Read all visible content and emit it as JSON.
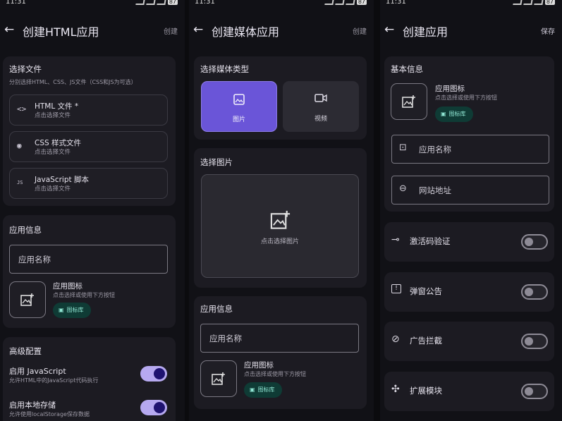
{
  "status": {
    "time": "11:31",
    "battery": "87"
  },
  "screen1": {
    "title": "创建HTML应用",
    "action": "创建",
    "select_files": {
      "heading": "选择文件",
      "hint": "分别选择HTML、CSS、JS文件（CSS和JS为可选）",
      "items": [
        {
          "icon": "code-icon",
          "glyph": "<>",
          "title": "HTML 文件 *",
          "sub": "点击选择文件"
        },
        {
          "icon": "palette-icon",
          "glyph": "◉",
          "title": "CSS 样式文件",
          "sub": "点击选择文件"
        },
        {
          "icon": "js-icon",
          "glyph": "JS",
          "title": "JavaScript 脚本",
          "sub": "点击选择文件"
        }
      ]
    },
    "app_info": {
      "heading": "应用信息",
      "name_placeholder": "应用名称",
      "icon_title": "应用图标",
      "icon_sub": "点击选择或使用下方按钮",
      "chip": "图标库"
    },
    "advanced": {
      "heading": "高级配置",
      "items": [
        {
          "title": "启用 JavaScript",
          "sub": "允许HTML中的JavaScript代码执行",
          "on": true
        },
        {
          "title": "启用本地存储",
          "sub": "允许使用localStorage保存数据",
          "on": true
        }
      ]
    }
  },
  "screen2": {
    "title": "创建媒体应用",
    "action": "创建",
    "media_type": {
      "heading": "选择媒体类型",
      "options": [
        {
          "label": "图片",
          "icon": "image-icon",
          "selected": true
        },
        {
          "label": "视频",
          "icon": "video-icon",
          "selected": false
        }
      ]
    },
    "pick_image": {
      "heading": "选择图片",
      "hint": "点击选择图片"
    },
    "app_info": {
      "heading": "应用信息",
      "name_placeholder": "应用名称",
      "icon_title": "应用图标",
      "icon_sub": "点击选择或使用下方按钮",
      "chip": "图标库"
    }
  },
  "screen3": {
    "title": "创建应用",
    "action": "保存",
    "basic": {
      "heading": "基本信息",
      "icon_title": "应用图标",
      "icon_sub": "点击选择或使用下方按钮",
      "chip": "图标库",
      "name_placeholder": "应用名称",
      "url_placeholder": "网站地址"
    },
    "options": [
      {
        "label": "激活码验证",
        "icon": "key-icon",
        "glyph": "⊸",
        "on": false
      },
      {
        "label": "弹窗公告",
        "icon": "announcement-icon",
        "glyph": "!",
        "on": false
      },
      {
        "label": "广告拦截",
        "icon": "block-icon",
        "glyph": "⊘",
        "on": false
      },
      {
        "label": "扩展模块",
        "icon": "puzzle-icon",
        "glyph": "✣",
        "on": false
      }
    ]
  },
  "colors": {
    "accent": "#6a55d8",
    "toggle_on": "#b6a9f0",
    "chip_bg": "#0f3b35",
    "chip_text": "#8fe6d3"
  }
}
